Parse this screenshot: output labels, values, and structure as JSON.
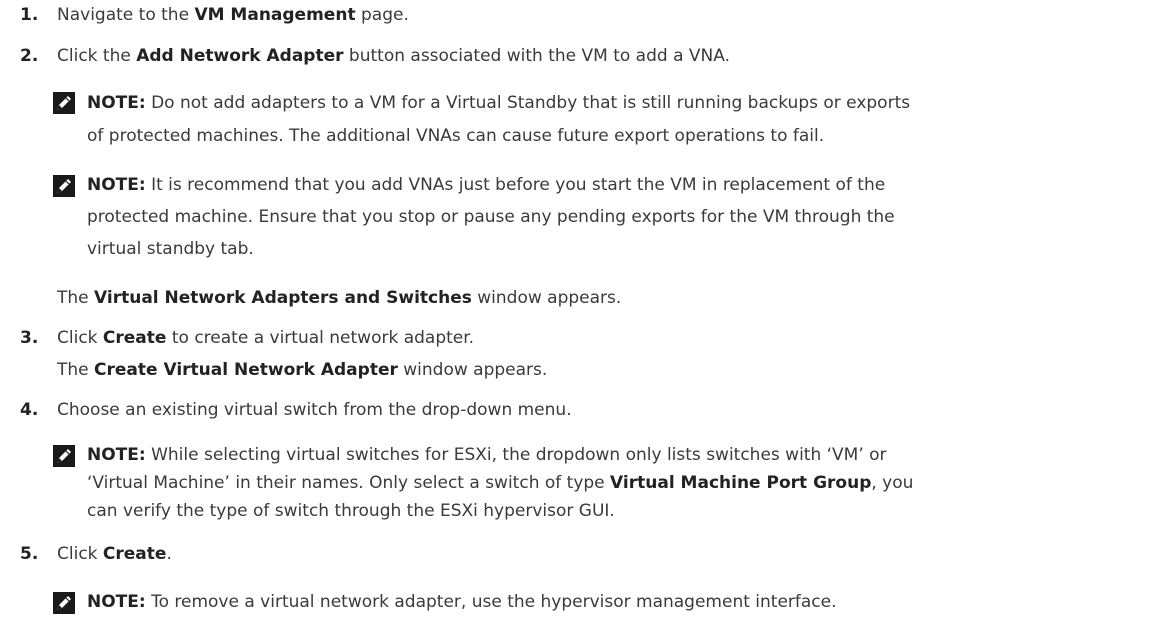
{
  "steps": [
    {
      "number": "1.",
      "pre": "Navigate to the ",
      "bold": "VM Management",
      "post": " page."
    },
    {
      "number": "2.",
      "pre": "Click the ",
      "bold": "Add Network Adapter",
      "post": " button associated with the VM to add a VNA."
    },
    {
      "number": "3.",
      "pre": "Click ",
      "bold": "Create",
      "post": " to create a virtual network adapter."
    },
    {
      "number": "4.",
      "text": "Choose an existing virtual switch from the drop-down menu."
    },
    {
      "number": "5.",
      "pre": "Click ",
      "bold": "Create",
      "post": "."
    }
  ],
  "note_label": "NOTE:",
  "notes": {
    "n1": {
      "line1": " Do not add adapters to a VM for a Virtual Standby that is still running backups or exports",
      "line2": "of protected machines. The additional VNAs can cause future export operations to fail."
    },
    "n2": {
      "line1": " It is recommend that you add VNAs just before you start the VM in replacement of the",
      "line2": "protected machine. Ensure that you stop or pause any pending exports for the VM through the",
      "line3": "virtual standby tab."
    },
    "n3": {
      "line1": " While selecting virtual switches for ESXi, the dropdown only lists switches with ‘VM’ or",
      "line2_pre": "‘Virtual Machine’ in their  names. Only select a switch of type ",
      "line2_bold": "Virtual Machine Port Group",
      "line2_post": ", you",
      "line3": "can verify the type of switch through the ESXi hypervisor GUI."
    },
    "n4": {
      "line1": " To remove a virtual network adapter, use the hypervisor management interface."
    }
  },
  "results": {
    "after_step2": {
      "pre": "The ",
      "bold": "Virtual Network Adapters and Switches",
      "post": " window appears."
    },
    "after_step3": {
      "pre": "The ",
      "bold": "Create Virtual Network Adapter",
      "post": " window appears."
    }
  }
}
